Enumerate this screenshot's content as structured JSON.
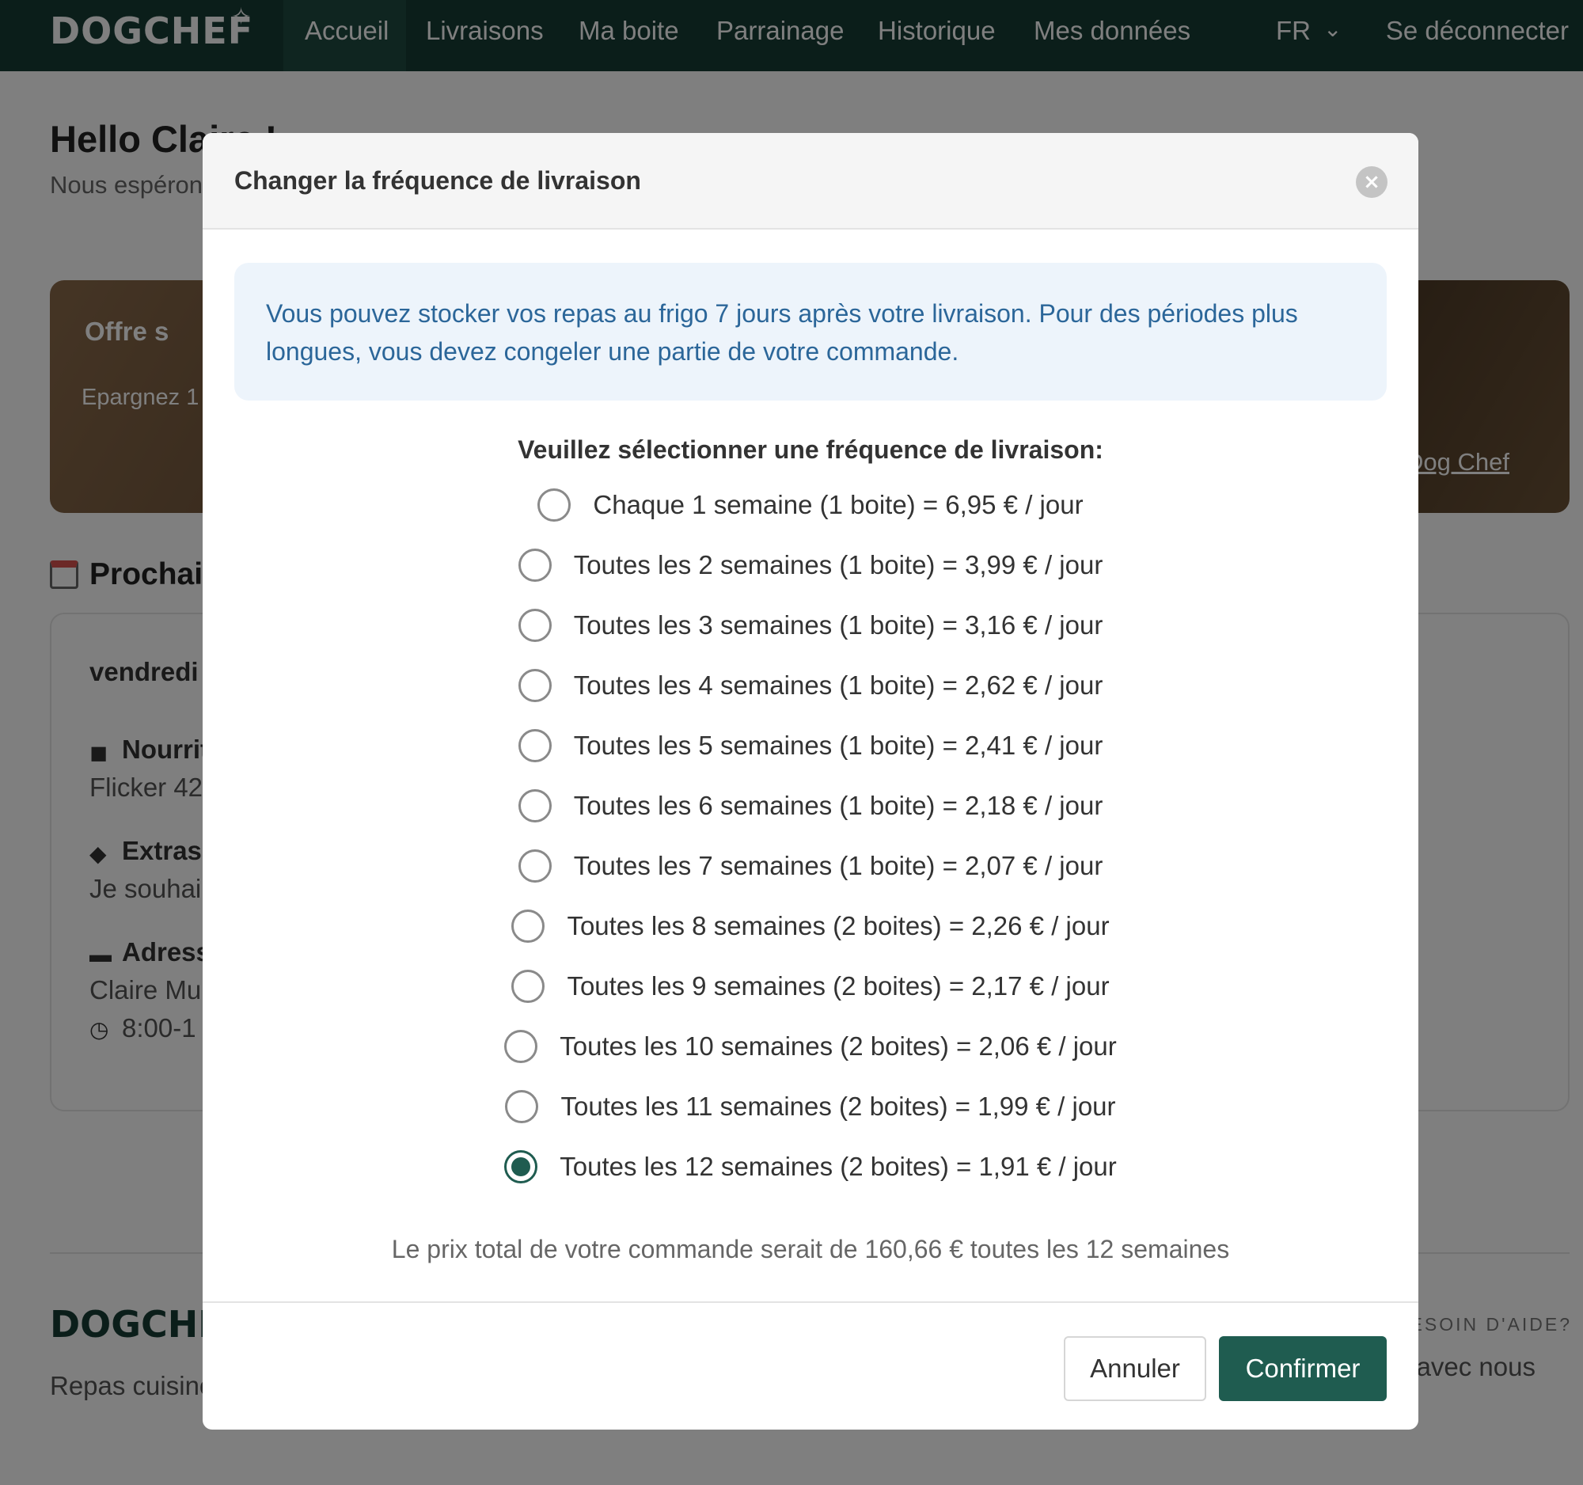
{
  "navbar": {
    "logo": "DOGCHEF",
    "items": [
      "Accueil",
      "Livraisons",
      "Ma boite",
      "Parrainage",
      "Historique",
      "Mes données"
    ],
    "language": "FR",
    "logout": "Se déconnecter"
  },
  "page": {
    "greeting": "Hello Claire !",
    "subtitle": "Nous espérons",
    "offer": {
      "title": "Offre s",
      "subtitle": "Epargnez 1",
      "link": "s Dog Chef"
    },
    "next_title": "Prochai",
    "card": {
      "day": "vendredi",
      "food_label": "Nourrit",
      "food_value": "Flicker 42",
      "extras_label": "Extras",
      "extras_value": "Je souhai",
      "address_label": "Adress",
      "address_value": "Claire Mu",
      "time_value": "8:00-1"
    },
    "footer": {
      "logo": "DOGCHEF",
      "tagline": "Repas cuisine",
      "help_title": "BESOIN D'AIDE?",
      "help_text": "avec nous"
    }
  },
  "modal": {
    "title": "Changer la fréquence de livraison",
    "info": "Vous pouvez stocker vos repas au frigo 7 jours après votre livraison. Pour des périodes plus longues, vous devez congeler une partie de votre commande.",
    "prompt": "Veuillez sélectionner une fréquence de livraison:",
    "options": [
      {
        "label": "Chaque 1 semaine (1 boite) = 6,95 € / jour",
        "selected": false
      },
      {
        "label": "Toutes les 2 semaines (1 boite) = 3,99 € / jour",
        "selected": false
      },
      {
        "label": "Toutes les 3 semaines (1 boite) = 3,16 € / jour",
        "selected": false
      },
      {
        "label": "Toutes les 4 semaines (1 boite) = 2,62 € / jour",
        "selected": false
      },
      {
        "label": "Toutes les 5 semaines (1 boite) = 2,41 € / jour",
        "selected": false
      },
      {
        "label": "Toutes les 6 semaines (1 boite) = 2,18 € / jour",
        "selected": false
      },
      {
        "label": "Toutes les 7 semaines (1 boite) = 2,07 € / jour",
        "selected": false
      },
      {
        "label": "Toutes les 8 semaines (2 boites) = 2,26 € / jour",
        "selected": false
      },
      {
        "label": "Toutes les 9 semaines (2 boites) = 2,17 € / jour",
        "selected": false
      },
      {
        "label": "Toutes les 10 semaines (2 boites) = 2,06 € / jour",
        "selected": false
      },
      {
        "label": "Toutes les 11 semaines (2 boites) = 1,99 € / jour",
        "selected": false
      },
      {
        "label": "Toutes les 12 semaines (2 boites) = 1,91 € / jour",
        "selected": true
      }
    ],
    "total": "Le prix total de votre commande serait de 160,66 € toutes les 12 semaines",
    "cancel": "Annuler",
    "confirm": "Confirmer"
  },
  "colors": {
    "nav_bg": "#173d35",
    "accent": "#1f5c50",
    "info_text": "#2b6699",
    "info_bg": "#edf4fb"
  }
}
